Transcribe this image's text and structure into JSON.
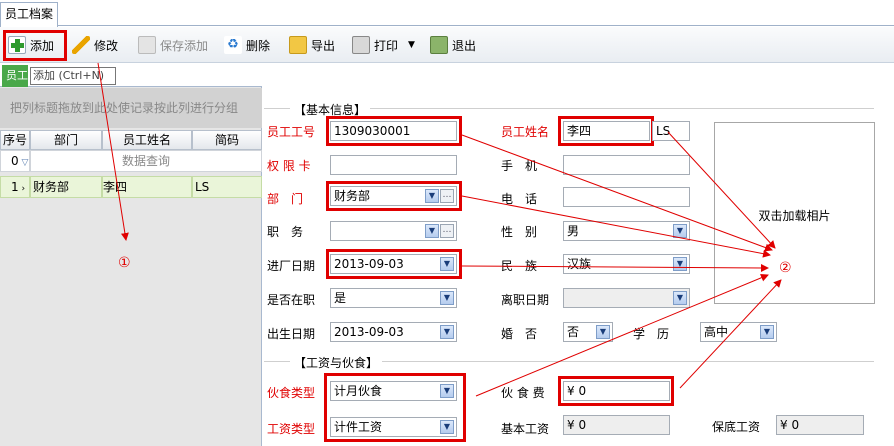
{
  "tabs": {
    "active": "员工档案"
  },
  "toolbar": {
    "add": "添加",
    "edit": "修改",
    "save_add": "保存添加",
    "delete": "删除",
    "export": "导出",
    "print": "打印",
    "exit": "退出",
    "tooltip": "添加 (Ctrl+N)"
  },
  "left": {
    "tab_label": "员工",
    "group_hint": "把列标题拖放到此处使记录按此列进行分组",
    "columns": [
      "序号",
      "部门",
      "员工姓名",
      "简码"
    ],
    "filter_row": {
      "index": "0",
      "text": "数据查询"
    },
    "rows": [
      {
        "index": "1",
        "dept": "财务部",
        "name": "李四",
        "code": "LS"
      }
    ]
  },
  "form": {
    "section_basic": "【基本信息】",
    "section_salary": "【工资与伙食】",
    "labels": {
      "emp_no": "员工工号",
      "emp_name": "员工姓名",
      "card": "权 限 卡",
      "mobile": "手　机",
      "dept": "部　门",
      "phone": "电　话",
      "position": "职　务",
      "gender": "性　别",
      "entry_date": "进厂日期",
      "nation": "民　族",
      "on_job": "是否在职",
      "leave_date": "离职日期",
      "birth": "出生日期",
      "marriage": "婚　否",
      "education": "学　历",
      "meal_type": "伙食类型",
      "meal_fee": "伙 食 费",
      "salary_type": "工资类型",
      "base_salary": "基本工资",
      "min_salary": "保底工资"
    },
    "values": {
      "emp_no": "1309030001",
      "emp_name": "李四",
      "short_code": "LS",
      "card": "",
      "mobile": "",
      "dept": "财务部",
      "phone": "",
      "position": "",
      "gender": "男",
      "entry_date": "2013-09-03",
      "nation": "汉族",
      "on_job": "是",
      "leave_date": "",
      "birth": "2013-09-03",
      "marriage": "否",
      "education": "高中",
      "meal_type": "计月伙食",
      "meal_fee": "¥ 0",
      "salary_type": "计件工资",
      "base_salary": "¥ 0",
      "min_salary": "¥ 0"
    },
    "photo_hint": "双击加载相片"
  },
  "annotations": {
    "one": "①",
    "two": "②"
  },
  "colors": {
    "highlight": "#e00000",
    "required_label": "#e00000",
    "selected_row": "#eaf5d9"
  }
}
